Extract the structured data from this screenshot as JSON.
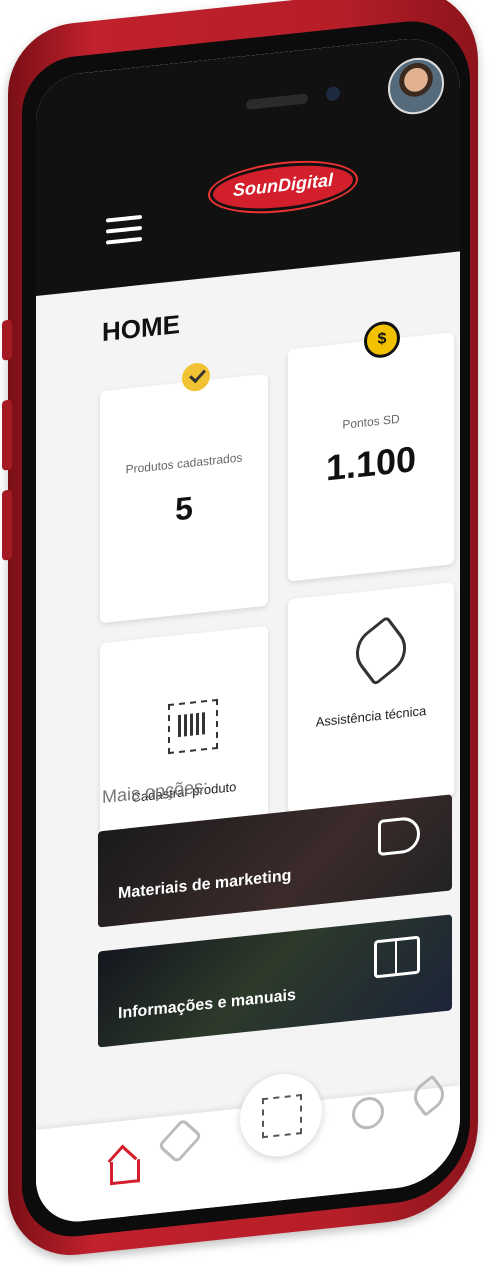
{
  "header": {
    "logo_text": "SounDigital"
  },
  "home": {
    "title": "HOME"
  },
  "cards": {
    "products": {
      "label": "Produtos cadastrados",
      "value": "5"
    },
    "points": {
      "label": "Pontos SD",
      "value": "1.100",
      "coin_symbol": "$"
    },
    "register": {
      "label": "Cadastrar produto"
    },
    "support": {
      "label": "Assistência técnica"
    }
  },
  "more_options": {
    "label": "Mais opções:",
    "items": [
      {
        "label": "Materiais de marketing"
      },
      {
        "label": "Informações e manuais"
      }
    ]
  },
  "nav": {
    "items": [
      "home-icon",
      "tag-icon",
      "barcode-icon",
      "award-icon",
      "wrench-icon"
    ]
  },
  "colors": {
    "brand_red": "#d21f2b",
    "coin_yellow": "#f2c200"
  }
}
